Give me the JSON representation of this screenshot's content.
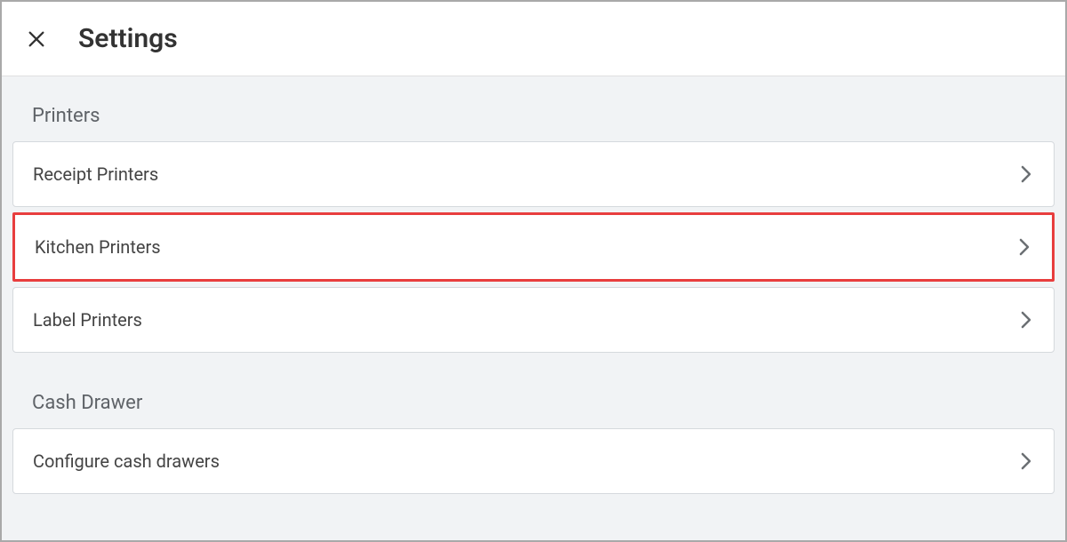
{
  "header": {
    "title": "Settings"
  },
  "sections": {
    "printers": {
      "title": "Printers",
      "items": [
        {
          "label": "Receipt Printers"
        },
        {
          "label": "Kitchen Printers"
        },
        {
          "label": "Label Printers"
        }
      ]
    },
    "cash_drawer": {
      "title": "Cash Drawer",
      "items": [
        {
          "label": "Configure cash drawers"
        }
      ]
    }
  }
}
